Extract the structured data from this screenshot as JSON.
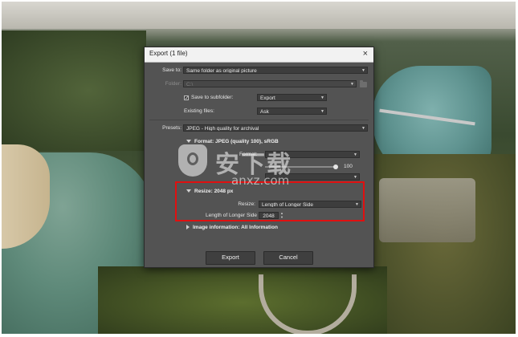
{
  "dialog": {
    "title": "Export (1 file)",
    "close_glyph": "×",
    "save_to": {
      "label": "Save to:",
      "value": "Same folder as original picture"
    },
    "folder": {
      "label": "Folder:",
      "value": "C:\\"
    },
    "subfolder": {
      "checked": true,
      "label": "Save to subfolder:",
      "value": "Export"
    },
    "existing_files": {
      "label": "Existing files:",
      "value": "Ask"
    },
    "presets": {
      "label": "Presets:",
      "value": "JPEG - High quality for archival"
    },
    "format_section": {
      "title": "Format: JPEG (quality 100), sRGB",
      "format_label": "Format:",
      "quality_value": "100"
    },
    "resize_section": {
      "title": "Resize: 2048 px",
      "resize_label": "Resize:",
      "resize_value": "Length of Longer Side",
      "longer_side_label": "Length of Longer Side",
      "longer_side_value": "2048"
    },
    "image_info_section": {
      "title": "Image information: All Information"
    },
    "buttons": {
      "export": "Export",
      "cancel": "Cancel"
    }
  },
  "colors": {
    "dialog_bg": "#535353",
    "highlight": "#e01010"
  },
  "watermark": {
    "main": "安下载",
    "sub": "anxz.com"
  }
}
